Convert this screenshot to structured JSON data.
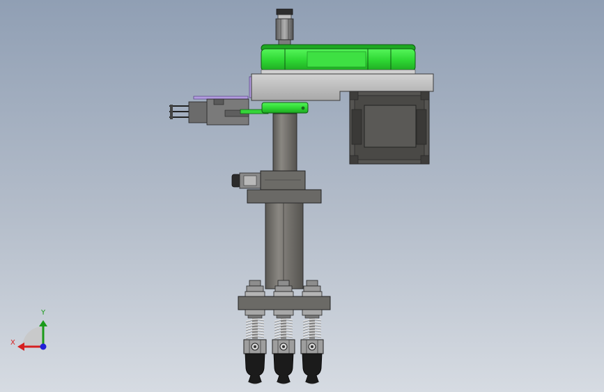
{
  "viewport": {
    "background_top": "#909fb4",
    "background_bottom": "#d6dbe2"
  },
  "model": {
    "belt_color": "#35e03a",
    "body_color": "#6f6d69",
    "plate_color": "#c4c4c4",
    "bracket_color": "#a58ad6"
  },
  "triad": {
    "x_label": "X",
    "y_label": "Y",
    "x_color": "#d62020",
    "y_color": "#1a9a1a",
    "z_color": "#2020d8"
  }
}
